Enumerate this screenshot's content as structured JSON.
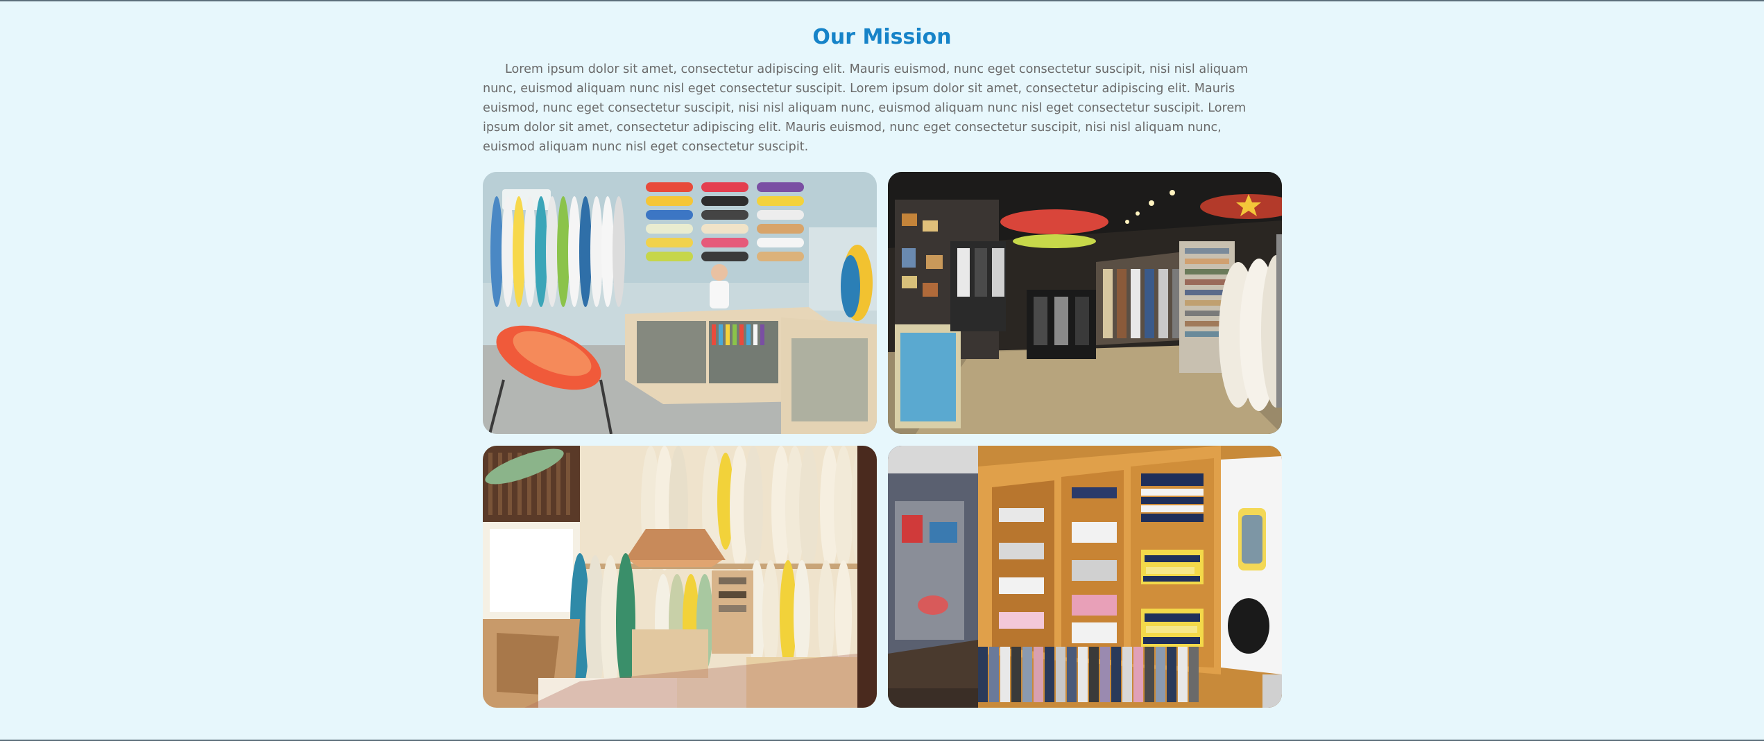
{
  "mission": {
    "title": "Our Mission",
    "paragraph": "Lorem ipsum dolor sit amet, consectetur adipiscing elit. Mauris euismod, nunc eget consectetur suscipit, nisi nisl aliquam nunc, euismod aliquam nunc nisl eget consectetur suscipit. Lorem ipsum dolor sit amet, consectetur adipiscing elit. Mauris euismod, nunc eget consectetur suscipit, nisi nisl aliquam nunc, euismod aliquam nunc nisl eget consectetur suscipit. Lorem ipsum dolor sit amet, consectetur adipiscing elit. Mauris euismod, nunc eget consectetur suscipit, nisi nisl aliquam nunc, euismod aliquam nunc nisl eget consectetur suscipit."
  },
  "gallery": {
    "images": [
      {
        "subject": "surf shop counter with surfboards and skateboard decks"
      },
      {
        "subject": "surf shop interior with clothing racks and surfboards"
      },
      {
        "subject": "surfboard showroom with wooden shelves"
      },
      {
        "subject": "surf apparel shelves with folded shirts"
      }
    ]
  },
  "colors": {
    "background": "#e7f7fc",
    "title": "#1683c8",
    "body_text": "#6a6a6a"
  }
}
